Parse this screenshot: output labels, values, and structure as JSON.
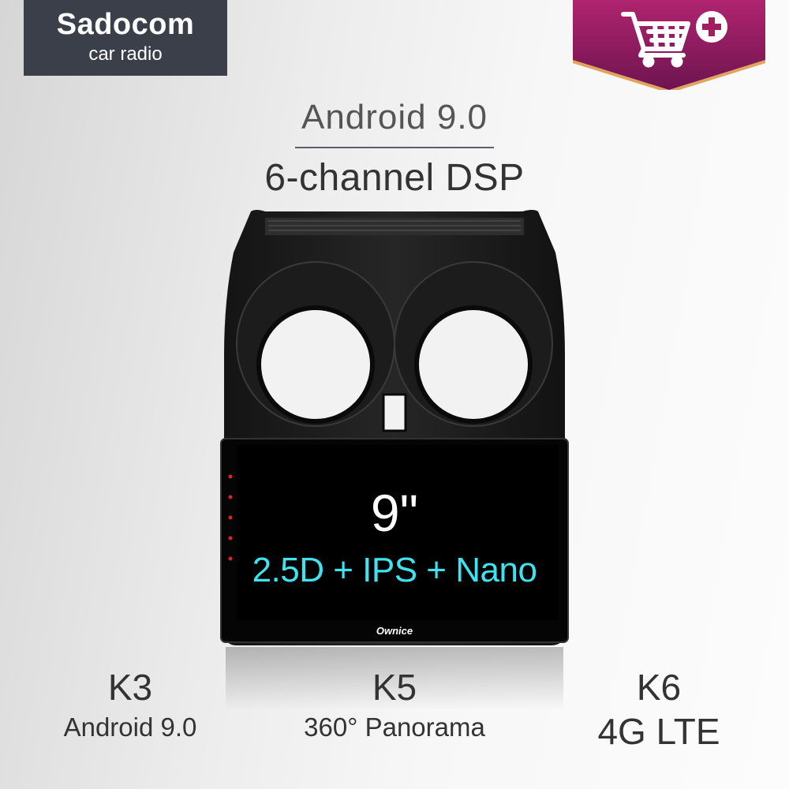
{
  "brand": {
    "name": "Sadocom",
    "subtitle": "car radio",
    "bg_color": "#3a3f49"
  },
  "cart": {
    "icon": "cart-plus-icon",
    "badge_color": "#8e1a5c"
  },
  "headline": {
    "os": "Android 9.0",
    "feature": "6-channel DSP"
  },
  "screen": {
    "size": "9\"",
    "tech": "2.5D + IPS + Nano",
    "logo": "Ownice",
    "text_color": "#3fe3f0"
  },
  "variants": [
    {
      "code": "K3",
      "feature": "Android 9.0"
    },
    {
      "code": "K5",
      "feature": "360° Panorama"
    },
    {
      "code": "K6",
      "feature": "4G LTE"
    }
  ]
}
